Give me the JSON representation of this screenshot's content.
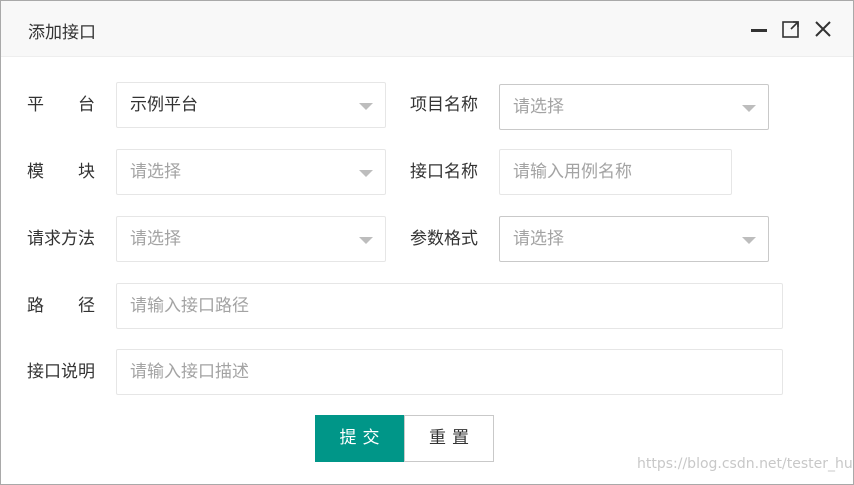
{
  "dialog": {
    "title": "添加接口",
    "controls": {
      "minimize": "minimize-icon",
      "maximize": "maximize-icon",
      "close": "close-icon"
    }
  },
  "form": {
    "platform": {
      "label": "平　　台",
      "value": "示例平台"
    },
    "project": {
      "label": "项目名称",
      "placeholder": "请选择"
    },
    "module": {
      "label": "模　　块",
      "placeholder": "请选择"
    },
    "api_name": {
      "label": "接口名称",
      "placeholder": "请输入用例名称"
    },
    "method": {
      "label": "请求方法",
      "placeholder": "请选择"
    },
    "param_fmt": {
      "label": "参数格式",
      "placeholder": "请选择"
    },
    "path": {
      "label": "路　　径",
      "placeholder": "请输入接口路径"
    },
    "desc": {
      "label": "接口说明",
      "placeholder": "请输入接口描述"
    }
  },
  "buttons": {
    "submit": "提交",
    "reset": "重置"
  },
  "watermark": "https://blog.csdn.net/tester_hu..."
}
